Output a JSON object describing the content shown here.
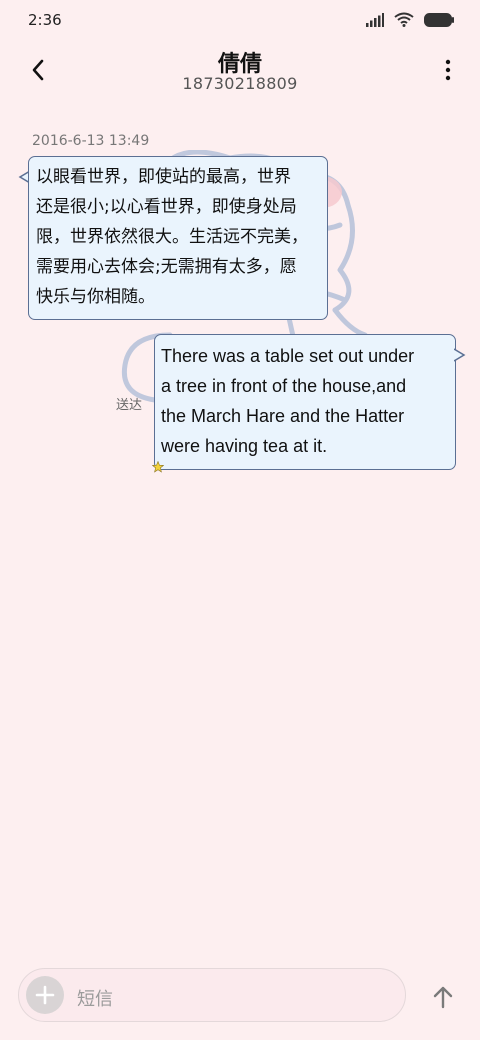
{
  "status_bar": {
    "time": "2:36"
  },
  "header": {
    "title": "倩倩",
    "subtitle": "18730218809"
  },
  "conversation": {
    "timestamp": "2016-6-13 13:49",
    "incoming": {
      "lines": [
        "以眼看世界，即使站的最高，世界",
        "还是很小;以心看世界，即使身处局",
        "限，世界依然很大。生活远不完美，",
        "需要用心去体会;无需拥有太多，愿",
        "快乐与你相随。"
      ]
    },
    "outgoing": {
      "lines": [
        "There was a table set out under",
        "a tree in front of the house,and",
        "the March Hare and the Hatter",
        "were having tea at it."
      ],
      "status": "送达"
    }
  },
  "composer": {
    "placeholder": "短信"
  },
  "colors": {
    "background": "#fdeff0",
    "bubble_fill": "#eaf4fd",
    "bubble_border": "#5b6f93"
  },
  "icons": [
    "signal-icon",
    "wifi-icon",
    "battery-icon",
    "back-arrow-icon",
    "more-vert-icon",
    "plus-icon",
    "send-arrow-icon",
    "star-icon"
  ]
}
